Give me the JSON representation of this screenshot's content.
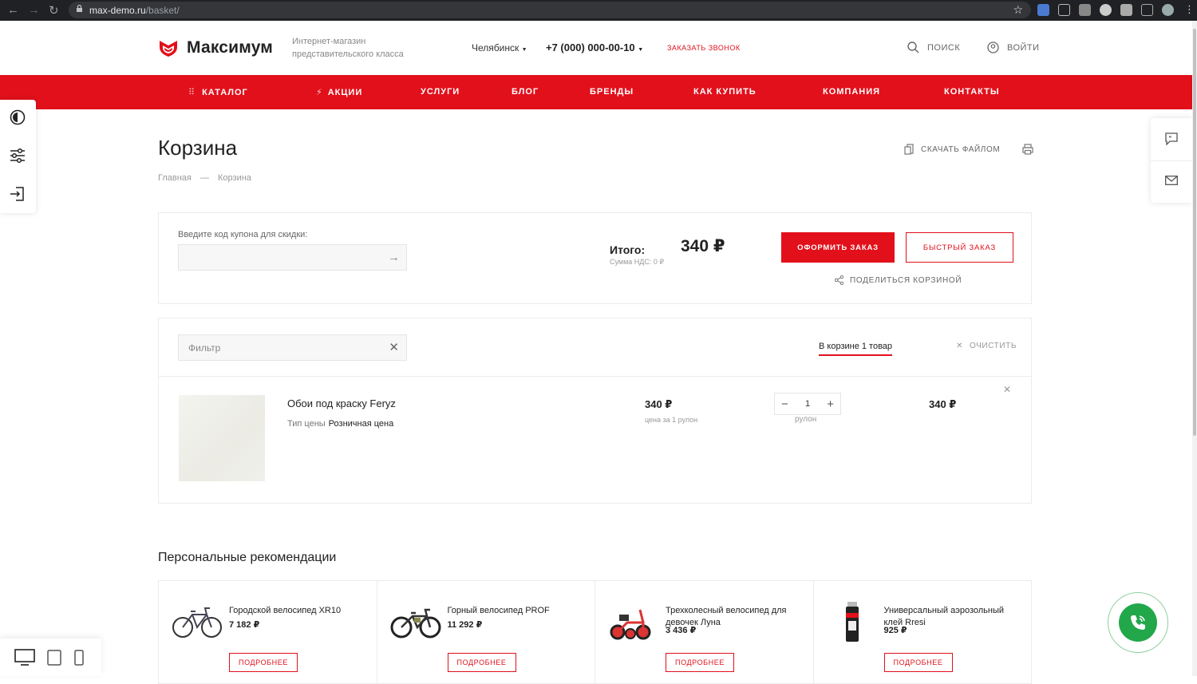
{
  "browser": {
    "url_host": "max-demo.ru",
    "url_path": "/basket/"
  },
  "header": {
    "logo_text": "Максимум",
    "slogan": "Интернет-магазин представительского класса",
    "city": "Челябинск",
    "phone": "+7 (000) 000-00-10",
    "callback": "ЗАКАЗАТЬ ЗВОНОК",
    "search": "ПОИСК",
    "login": "ВОЙТИ"
  },
  "menu": [
    "КАТАЛОГ",
    "АКЦИИ",
    "УСЛУГИ",
    "БЛОГ",
    "БРЕНДЫ",
    "КАК КУПИТЬ",
    "КОМПАНИЯ",
    "КОНТАКТЫ"
  ],
  "page": {
    "title": "Корзина",
    "breadcrumb_home": "Главная",
    "breadcrumb_sep": "—",
    "breadcrumb_current": "Корзина",
    "download": "СКАЧАТЬ ФАЙЛОМ"
  },
  "summary": {
    "coupon_label": "Введите код купона для скидки:",
    "coupon_value": "",
    "total_label": "Итого:",
    "total_value": "340 ₽",
    "vat": "Сумма НДС: 0 ₽",
    "order_button": "ОФОРМИТЬ ЗАКАЗ",
    "quick_button": "БЫСТРЫЙ ЗАКАЗ",
    "share": "ПОДЕЛИТЬСЯ КОРЗИНОЙ"
  },
  "basket": {
    "filter_placeholder": "Фильтр",
    "count": "В корзине 1 товар",
    "clear": "ОЧИСТИТЬ",
    "item": {
      "name": "Обои под краску Feryz",
      "price_type_label": "Тип цены",
      "price_type": "Розничная цена",
      "price": "340 ₽",
      "price_unit": "цена за 1 рулон",
      "qty": "1",
      "qty_unit": "рулон",
      "sum": "340 ₽"
    }
  },
  "recommendations": {
    "title": "Персональные рекомендации",
    "button_label": "ПОДРОБНЕЕ",
    "items": [
      {
        "name": "Городской велосипед XR10",
        "price": "7 182 ₽"
      },
      {
        "name": "Горный велосипед PROF",
        "price": "11 292 ₽"
      },
      {
        "name": "Трехколесный велосипед для девочек Луна",
        "price": "3 436 ₽"
      },
      {
        "name": "Универсальный аэрозольный клей Rresi",
        "price": "925 ₽"
      }
    ]
  },
  "colors": {
    "accent": "#e2101b",
    "call": "#23a74b"
  }
}
